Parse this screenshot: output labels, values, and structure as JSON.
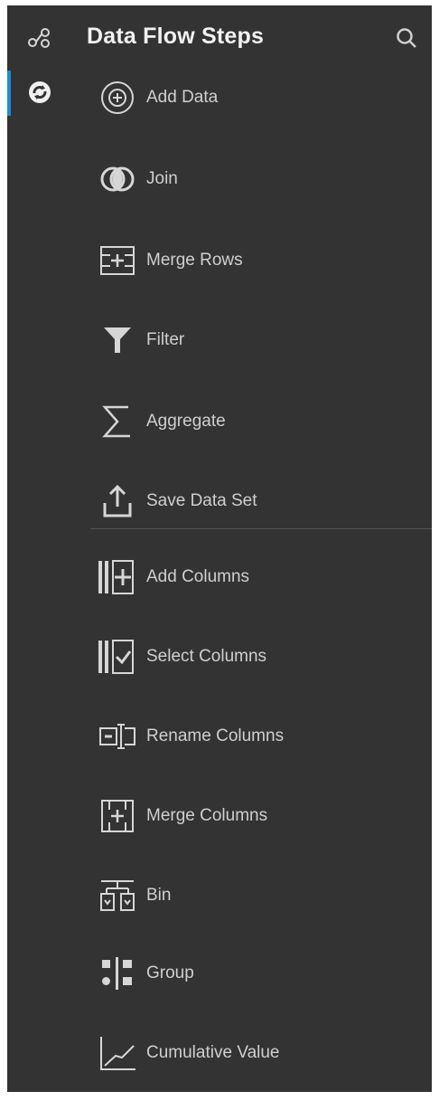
{
  "colors": {
    "background": "#333333",
    "accent": "#1d8ccf",
    "text": "#cfcfcf",
    "title": "#f2f2f2",
    "icon": "#d6d6d6"
  },
  "rail": {
    "items": [
      {
        "icon": "data-flow-icon",
        "active": false
      },
      {
        "icon": "refresh-steps-icon",
        "active": true
      }
    ]
  },
  "panel": {
    "title": "Data Flow Steps",
    "search_icon": "search-icon"
  },
  "steps_group1": [
    {
      "label": "Add Data",
      "icon": "add-data-icon"
    },
    {
      "label": "Join",
      "icon": "join-icon"
    },
    {
      "label": "Merge Rows",
      "icon": "merge-rows-icon"
    },
    {
      "label": "Filter",
      "icon": "filter-icon"
    },
    {
      "label": "Aggregate",
      "icon": "aggregate-icon"
    },
    {
      "label": "Save Data Set",
      "icon": "save-data-set-icon"
    }
  ],
  "steps_group2": [
    {
      "label": "Add Columns",
      "icon": "add-columns-icon"
    },
    {
      "label": "Select Columns",
      "icon": "select-columns-icon"
    },
    {
      "label": "Rename Columns",
      "icon": "rename-columns-icon"
    },
    {
      "label": "Merge Columns",
      "icon": "merge-columns-icon"
    },
    {
      "label": "Bin",
      "icon": "bin-icon"
    },
    {
      "label": "Group",
      "icon": "group-icon"
    },
    {
      "label": "Cumulative Value",
      "icon": "cumulative-value-icon"
    }
  ]
}
